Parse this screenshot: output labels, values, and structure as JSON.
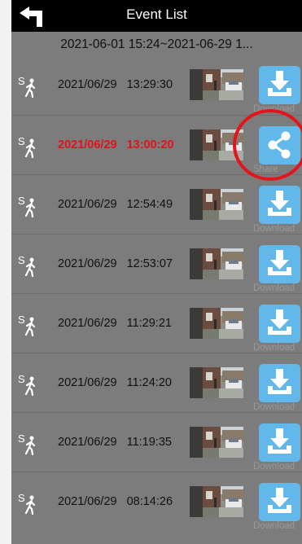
{
  "header": {
    "title": "Event List",
    "back_icon": "back-arrow-icon"
  },
  "range": "2021-06-01 15:24~2021-06-29 1...",
  "events": [
    {
      "s": "S",
      "date": "2021/06/29",
      "time": "13:29:30",
      "action": "Download",
      "icon": "download-icon",
      "highlight": false
    },
    {
      "s": "S",
      "date": "2021/06/29",
      "time": "13:00:20",
      "action": "Share",
      "icon": "share-icon",
      "highlight": true
    },
    {
      "s": "S",
      "date": "2021/06/29",
      "time": "12:54:49",
      "action": "Download",
      "icon": "download-icon",
      "highlight": false
    },
    {
      "s": "S",
      "date": "2021/06/29",
      "time": "12:53:07",
      "action": "Download",
      "icon": "download-icon",
      "highlight": false
    },
    {
      "s": "S",
      "date": "2021/06/29",
      "time": "11:29:21",
      "action": "Download",
      "icon": "download-icon",
      "highlight": false
    },
    {
      "s": "S",
      "date": "2021/06/29",
      "time": "11:24:20",
      "action": "Download",
      "icon": "download-icon",
      "highlight": false
    },
    {
      "s": "S",
      "date": "2021/06/29",
      "time": "11:19:35",
      "action": "Download",
      "icon": "download-icon",
      "highlight": false
    },
    {
      "s": "S",
      "date": "2021/06/29",
      "time": "08:14:26",
      "action": "Download",
      "icon": "download-icon",
      "highlight": false
    }
  ],
  "colors": {
    "highlight": "#e0121c",
    "action_button": "#62b8ea",
    "annotation_circle": "#e3141c"
  }
}
